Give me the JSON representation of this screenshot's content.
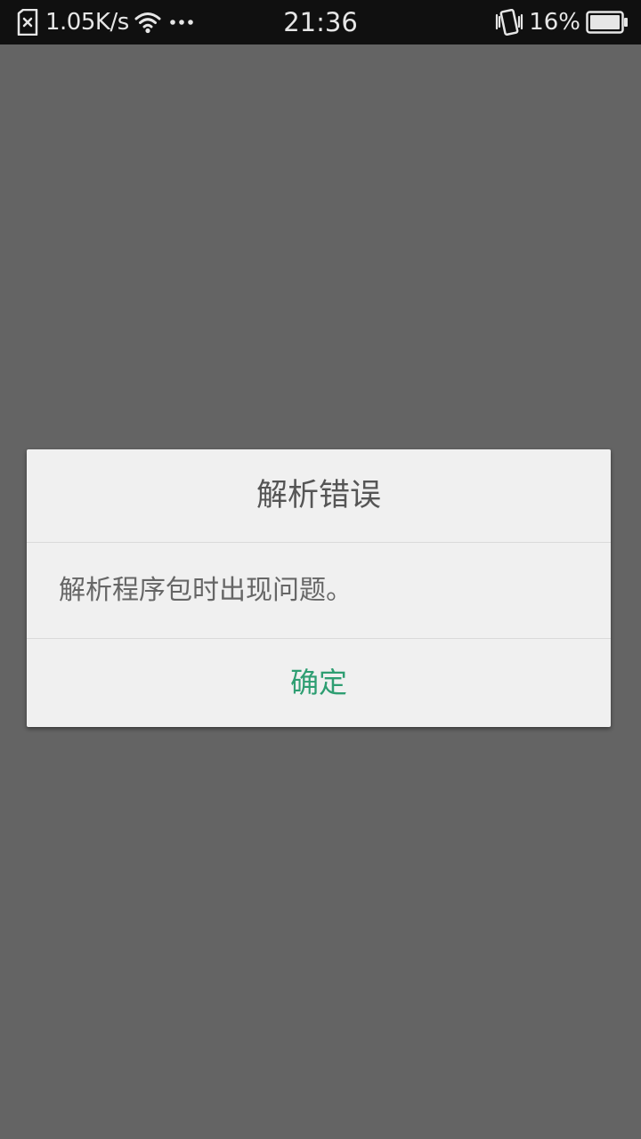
{
  "status_bar": {
    "net_speed": "1.05K/s",
    "time": "21:36",
    "battery_percent": "16%",
    "battery_level": 0.16,
    "icons": [
      "no-sim-icon",
      "wifi-icon",
      "more-dots-icon",
      "vibrate-icon",
      "battery-icon"
    ]
  },
  "dialog": {
    "title": "解析错误",
    "message": "解析程序包时出现问题。",
    "ok_label": "确定"
  },
  "colors": {
    "background": "#646464",
    "status_bar": "#101010",
    "dialog": "#f0f0f0",
    "accent": "#2e9e72"
  }
}
